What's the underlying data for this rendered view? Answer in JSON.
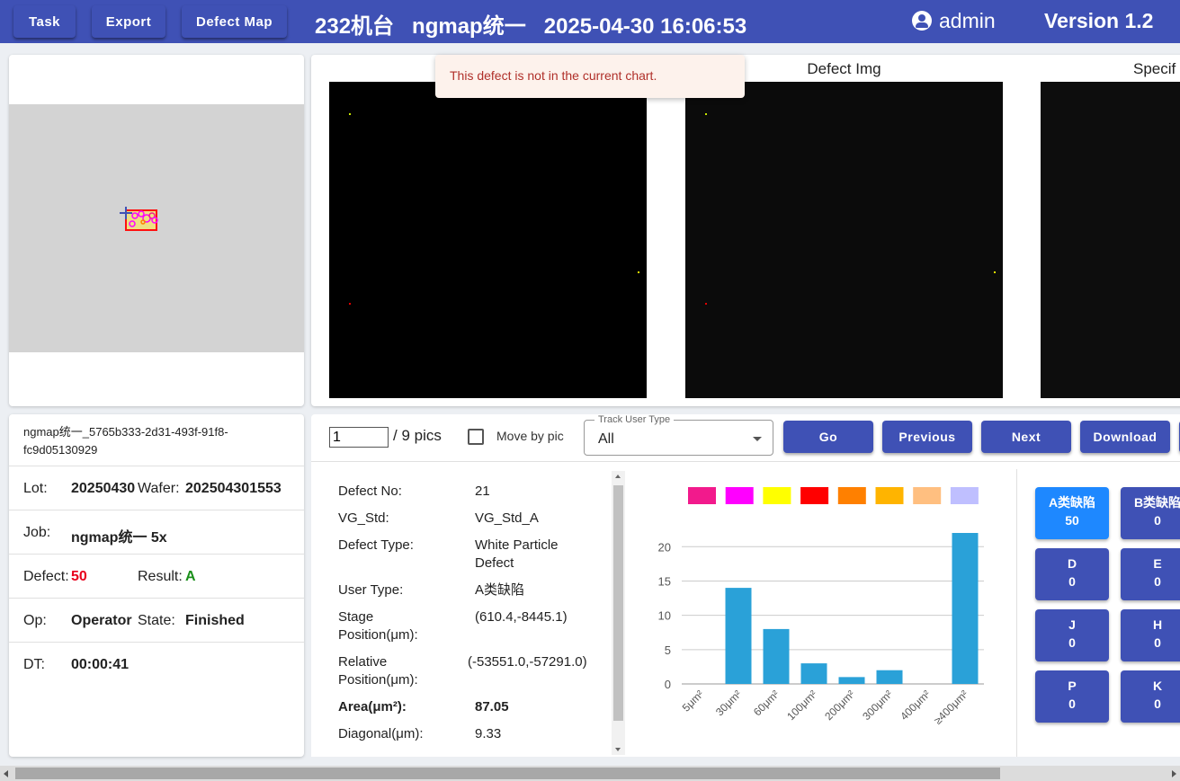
{
  "topbar": {
    "task_label": "Task",
    "export_label": "Export",
    "defect_map_label": "Defect Map",
    "title": "232机台   ngmap统一   2025-04-30 16:06:53",
    "user": "admin",
    "version": "Version 1.2"
  },
  "images": {
    "label_1": "",
    "label_2": "Defect Img",
    "label_3": "Specif"
  },
  "toast": {
    "message": "This defect is not in the current chart."
  },
  "info": {
    "id": "ngmap统一_5765b333-2d31-493f-91f8-fc9d05130929",
    "lot_label": "Lot:",
    "lot_value": "20250430",
    "wafer_label": "Wafer:",
    "wafer_value": "202504301553",
    "job_label": "Job:",
    "job_value": "ngmap统一 5x",
    "defect_label": "Defect:",
    "defect_value": "50",
    "result_label": "Result:",
    "result_value": "A",
    "op_label": "Op:",
    "op_value": "Operator",
    "state_label": "State:",
    "state_value": "Finished",
    "dt_label": "DT:",
    "dt_value": "00:00:41"
  },
  "controls": {
    "page_value": "1",
    "page_total": "/ 9 pics",
    "move_by_pic": "Move by pic",
    "track_label": "Track User Type",
    "track_value": "All",
    "go": "Go",
    "previous": "Previous",
    "next": "Next",
    "download": "Download"
  },
  "details": [
    {
      "label": "Defect No:",
      "value": "21"
    },
    {
      "label": "VG_Std:",
      "value": "VG_Std_A"
    },
    {
      "label": "Defect Type:",
      "value": "White Particle Defect"
    },
    {
      "label": "User Type:",
      "value": "A类缺陷"
    },
    {
      "label": "Stage Position(μm):",
      "value": "(610.4,-8445.1)"
    },
    {
      "label": "Relative Position(μm):",
      "value": "(-53551.0,-57291.0)"
    },
    {
      "label": "Area(μm²):",
      "value": "87.05"
    },
    {
      "label": "Diagonal(μm):",
      "value": "9.33"
    }
  ],
  "colors": {
    "primary": "#3f51b5",
    "active": "#1e88ff",
    "bar": "#2aa1d8",
    "defect_value": "#e8001c",
    "result_value": "#1a8f1a",
    "toast_text": "#b0302a",
    "legend": [
      "#f21a8c",
      "#ff00ff",
      "#ffff00",
      "#ff0000",
      "#ff8000",
      "#ffb400",
      "#ffbf80",
      "#bfbfff"
    ]
  },
  "chart_data": {
    "type": "bar",
    "categories": [
      "5μm²",
      "30μm²",
      "60μm²",
      "100μm²",
      "200μm²",
      "300μm²",
      "400μm²",
      "≥400μm²"
    ],
    "values": [
      0,
      14,
      8,
      3,
      1,
      2,
      0,
      22
    ],
    "yticks": [
      0,
      5,
      10,
      15,
      20
    ],
    "ylim": [
      0,
      22
    ],
    "grid": true
  },
  "categories": [
    {
      "name": "A类缺陷",
      "count": "50"
    },
    {
      "name": "B类缺陷",
      "count": "0"
    },
    {
      "name": "D",
      "count": "0"
    },
    {
      "name": "E",
      "count": "0"
    },
    {
      "name": "J",
      "count": "0"
    },
    {
      "name": "H",
      "count": "0"
    },
    {
      "name": "P",
      "count": "0"
    },
    {
      "name": "K",
      "count": "0"
    }
  ]
}
